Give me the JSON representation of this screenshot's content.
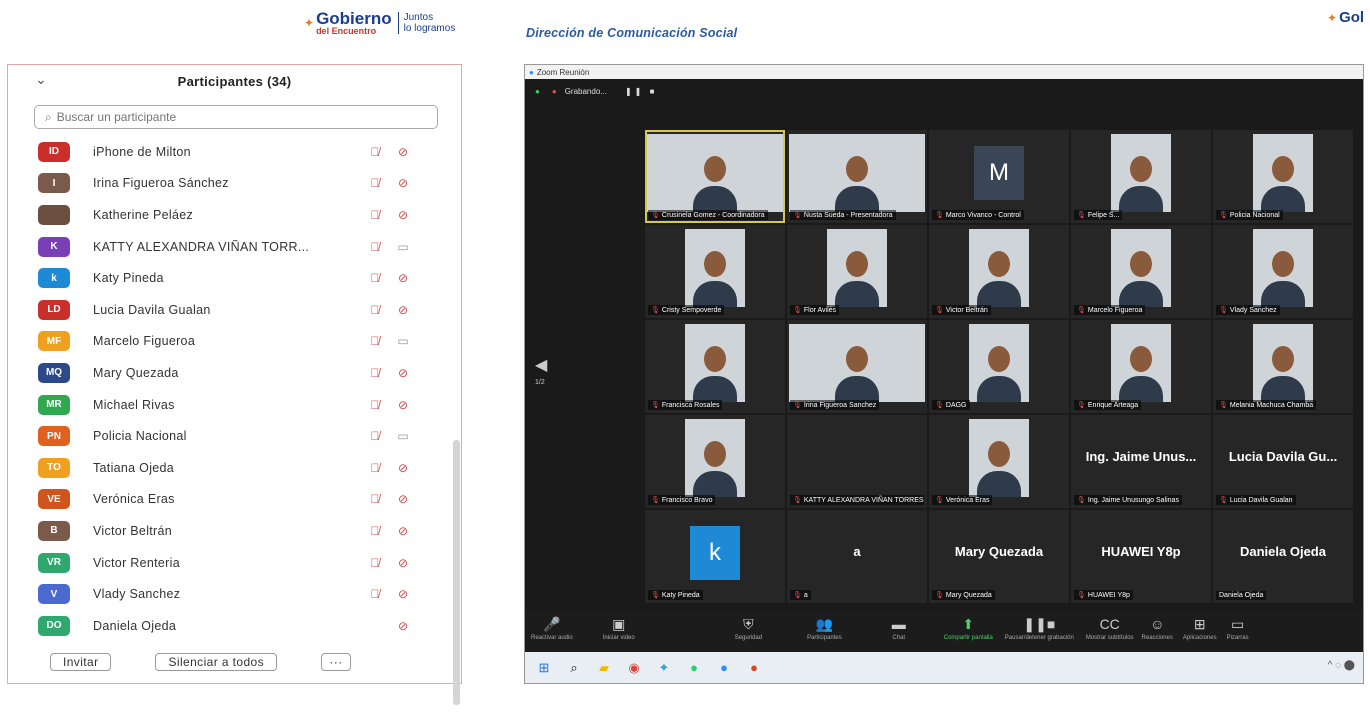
{
  "logo": {
    "name": "Gobierno",
    "sub": "del Encuentro",
    "tagline_1": "Juntos",
    "tagline_2": "lo logramos",
    "right_partial": "Gol"
  },
  "header": {
    "right_title": "Dirección de Comunicación Social"
  },
  "participants_panel": {
    "title": "Participantes (34)",
    "search_placeholder": "Buscar un participante",
    "participants": [
      {
        "initials": "ID",
        "color": "#c9302c",
        "name": "iPhone de Milton",
        "mic": "muted",
        "video": "off"
      },
      {
        "initials": "I",
        "color": "#7a5a4a",
        "name": "Irina Figueroa Sánchez",
        "mic": "muted",
        "video": "off"
      },
      {
        "initials": "",
        "color": "#6b5040",
        "name": "Katherine Peláez",
        "mic": "muted",
        "video": "off"
      },
      {
        "initials": "K",
        "color": "#7b3fb5",
        "name": "KATTY ALEXANDRA VIÑAN TORR...",
        "mic": "muted",
        "video": "on"
      },
      {
        "initials": "k",
        "color": "#1e8ad6",
        "name": "Katy Pineda",
        "mic": "muted",
        "video": "off"
      },
      {
        "initials": "LD",
        "color": "#c9302c",
        "name": "Lucia Davila Gualan",
        "mic": "muted",
        "video": "off"
      },
      {
        "initials": "MF",
        "color": "#f0a020",
        "name": "Marcelo Figueroa",
        "mic": "muted",
        "video": "on"
      },
      {
        "initials": "MQ",
        "color": "#2c4a8a",
        "name": "Mary Quezada",
        "mic": "muted",
        "video": "off"
      },
      {
        "initials": "MR",
        "color": "#2fa84f",
        "name": "Michael Rivas",
        "mic": "muted",
        "video": "off"
      },
      {
        "initials": "PN",
        "color": "#e06020",
        "name": "Policia Nacional",
        "mic": "muted",
        "video": "on"
      },
      {
        "initials": "TO",
        "color": "#f0a020",
        "name": "Tatiana Ojeda",
        "mic": "muted",
        "video": "off"
      },
      {
        "initials": "VE",
        "color": "#d0541e",
        "name": "Verónica Eras",
        "mic": "muted",
        "video": "off"
      },
      {
        "initials": "B",
        "color": "#7a5a4a",
        "name": "Victor Beltrán",
        "mic": "muted",
        "video": "off"
      },
      {
        "initials": "VR",
        "color": "#2fa86f",
        "name": "Victor Renteria",
        "mic": "muted",
        "video": "off"
      },
      {
        "initials": "V",
        "color": "#4a6ad0",
        "name": "Vlady Sanchez",
        "mic": "muted",
        "video": "off"
      },
      {
        "initials": "DO",
        "color": "#2fa86f",
        "name": "Daniela Ojeda",
        "mic": "none",
        "video": "off"
      }
    ],
    "invite_label": "Invitar",
    "mute_all_label": "Silenciar a todos",
    "more_label": "···"
  },
  "zoom": {
    "window_title": "Zoom Reunión",
    "recording_label": "Grabando...",
    "page_indicator": "1/2",
    "tiles": [
      {
        "name": "Crusinela Gomez - Coordinadora",
        "kind": "photo",
        "highlight": true,
        "wide": true
      },
      {
        "name": "Nusta Sueda - Presentadora",
        "kind": "photo",
        "wide": true
      },
      {
        "name": "Marco Vivanco - Control",
        "kind": "avatar",
        "avatar": "M",
        "avatar_color": "#3a4656"
      },
      {
        "name": "Felipe S...",
        "kind": "photo"
      },
      {
        "name": "Policia Nacional",
        "kind": "photo"
      },
      {
        "name": "Cristy Sempoverde",
        "kind": "photo"
      },
      {
        "name": "Flor Avilés",
        "kind": "photo"
      },
      {
        "name": "Victor Beltrán",
        "kind": "photo"
      },
      {
        "name": "Marcelo Figueroa",
        "kind": "photo"
      },
      {
        "name": "Vlady Sanchez",
        "kind": "photo"
      },
      {
        "name": "Francisca Rosales",
        "kind": "photo"
      },
      {
        "name": "Irina Figueroa Sanchez",
        "kind": "photo",
        "wide": true
      },
      {
        "name": "DAGG",
        "kind": "photo"
      },
      {
        "name": "Enrique Arteaga",
        "kind": "photo"
      },
      {
        "name": "Melania Machuca Chamba",
        "kind": "photo"
      },
      {
        "name": "Francisco Bravo",
        "kind": "photo"
      },
      {
        "name": "KATTY ALEXANDRA VIÑAN TORRES",
        "kind": "empty"
      },
      {
        "name": "Verónica Eras",
        "kind": "photo"
      },
      {
        "name": "Ing. Jaime Unusungo Salinas",
        "kind": "text",
        "display": "Ing. Jaime Unus..."
      },
      {
        "name": "Lucia Davila Gualan",
        "kind": "text",
        "display": "Lucia Davila Gu..."
      },
      {
        "name": "Katy Pineda",
        "kind": "avatar",
        "avatar": "k",
        "avatar_color": "#1e8ad6"
      },
      {
        "name": "a",
        "kind": "text",
        "display": "a"
      },
      {
        "name": "Mary Quezada",
        "kind": "text",
        "display": "Mary Quezada"
      },
      {
        "name": "HUAWEI Y8p",
        "kind": "text",
        "display": "HUAWEI Y8p"
      },
      {
        "name": "Daniela Ojeda",
        "kind": "text",
        "display": "Daniela Ojeda",
        "no_mic": true
      }
    ],
    "toolbar": [
      {
        "icon": "mic-off-icon",
        "glyph": "🎤",
        "label": "Reactivar audio"
      },
      {
        "icon": "video-off-icon",
        "glyph": "▣",
        "label": "Iniciar video"
      },
      {
        "icon": "shield-icon",
        "glyph": "⛨",
        "label": "Seguridad"
      },
      {
        "icon": "participants-icon",
        "glyph": "👥",
        "label": "Participantes"
      },
      {
        "icon": "chat-icon",
        "glyph": "▬",
        "label": "Chat"
      },
      {
        "icon": "share-screen-icon",
        "glyph": "⬆",
        "label": "Compartir pantalla",
        "green": true
      },
      {
        "icon": "record-icon",
        "glyph": "❚❚■",
        "label": "Pausar/detener grabación"
      },
      {
        "icon": "cc-icon",
        "glyph": "CC",
        "label": "Mostrar subtítulos"
      },
      {
        "icon": "reactions-icon",
        "glyph": "☺",
        "label": "Reacciones"
      },
      {
        "icon": "apps-icon",
        "glyph": "⊞",
        "label": "Aplicaciones"
      },
      {
        "icon": "whiteboard-icon",
        "glyph": "▭",
        "label": "Pizarras"
      }
    ],
    "taskbar": [
      {
        "icon": "windows-start-icon",
        "glyph": "⊞",
        "color": "#1a73e8"
      },
      {
        "icon": "search-icon",
        "glyph": "⌕",
        "color": "#222"
      },
      {
        "icon": "file-explorer-icon",
        "glyph": "▰",
        "color": "#f2b705"
      },
      {
        "icon": "chrome-icon",
        "glyph": "◉",
        "color": "#db4437"
      },
      {
        "icon": "app-icon",
        "glyph": "✦",
        "color": "#3aa0c8"
      },
      {
        "icon": "whatsapp-icon",
        "glyph": "●",
        "color": "#25d366"
      },
      {
        "icon": "zoom-icon",
        "glyph": "●",
        "color": "#2d8cff"
      },
      {
        "icon": "powerpoint-icon",
        "glyph": "●",
        "color": "#d24726"
      }
    ]
  }
}
